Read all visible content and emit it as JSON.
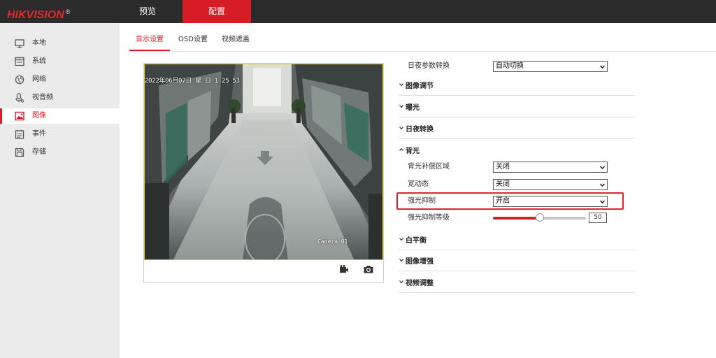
{
  "brand": {
    "logo_text": "HIKVISION",
    "logo_mark": "®",
    "accent": "#d61c25"
  },
  "nav": {
    "tabs": [
      {
        "label": "预览"
      },
      {
        "label": "配置"
      }
    ],
    "active": 1
  },
  "sidebar": {
    "items": [
      {
        "label": "本地",
        "icon": "monitor-icon"
      },
      {
        "label": "系统",
        "icon": "window-icon"
      },
      {
        "label": "网络",
        "icon": "globe-icon"
      },
      {
        "label": "视音频",
        "icon": "microphone-icon"
      },
      {
        "label": "图像",
        "icon": "image-icon"
      },
      {
        "label": "事件",
        "icon": "calendar-icon"
      },
      {
        "label": "存储",
        "icon": "save-icon"
      }
    ],
    "active": 4
  },
  "subtabs": {
    "items": [
      {
        "label": "显示设置"
      },
      {
        "label": "OSD设置"
      },
      {
        "label": "视频遮盖"
      }
    ],
    "active": 0
  },
  "video": {
    "osd_time": "2022年06月07日 星 日 1 25 53",
    "osd_camera": "Camera 01",
    "record_icon": "video-record-icon",
    "capture_icon": "camera-capture-icon"
  },
  "settings": {
    "day_night_switch": {
      "label": "日夜参数转换",
      "value": "自动切换"
    },
    "sections": {
      "image_adjust": "图像调节",
      "exposure": "曝光",
      "day_night": "日夜转换",
      "backlight": "背光",
      "white_balance": "白平衡",
      "image_enhance": "图像增强",
      "video_adjust": "视频调整"
    },
    "backlight": {
      "blc_area": {
        "label": "背光补偿区域",
        "value": "关闭"
      },
      "wdr": {
        "label": "宽动态",
        "value": "关闭"
      },
      "hlc": {
        "label": "强光抑制",
        "value": "开启"
      },
      "hlc_level": {
        "label": "强光抑制等级",
        "value": "50",
        "fraction": 0.5
      }
    }
  }
}
